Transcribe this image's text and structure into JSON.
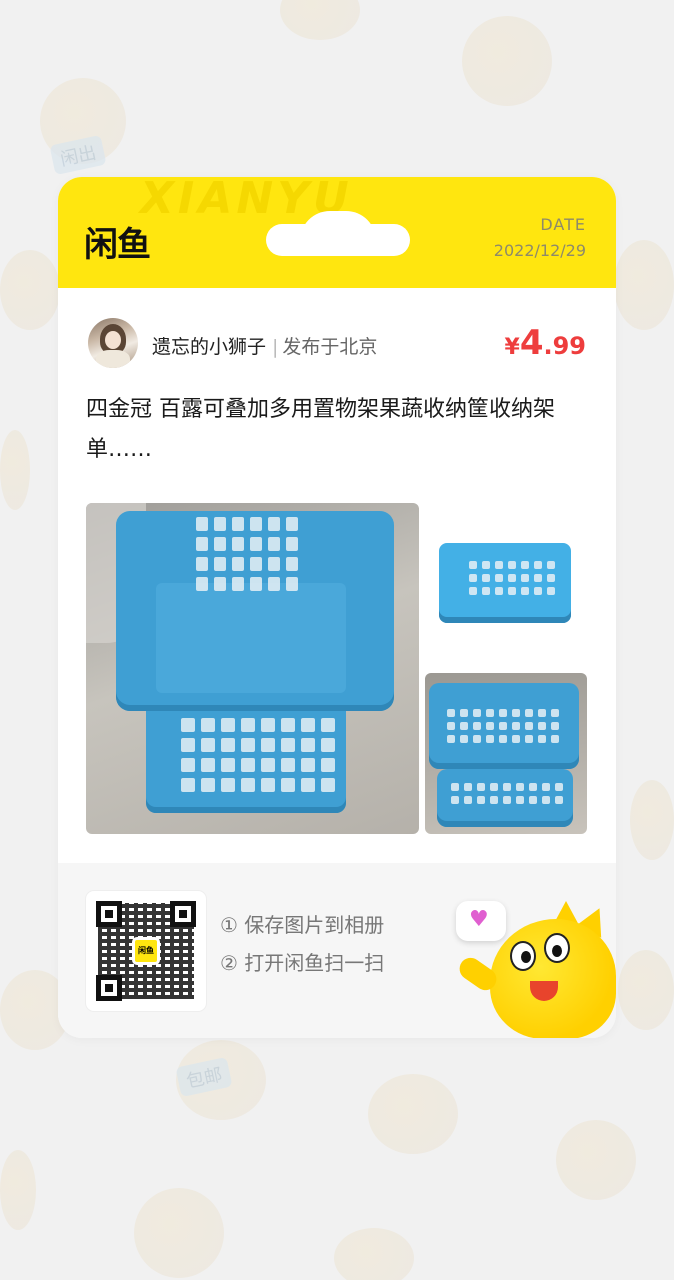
{
  "background": {
    "tags": [
      "闲出",
      "包邮"
    ]
  },
  "header": {
    "logo": "闲鱼",
    "watermark": "XIANYU",
    "date_label": "DATE",
    "date_value": "2022/12/29",
    "color": "#ffe60f"
  },
  "seller": {
    "name": "遗忘的小狮子",
    "separator": "|",
    "location": "发布于北京"
  },
  "price": {
    "currency": "¥",
    "integer": "4",
    "decimal": ".99",
    "color": "#ee3d3d"
  },
  "item": {
    "title": "四金冠 百露可叠加多用置物架果蔬收纳筐收纳架 单……"
  },
  "footer": {
    "qr_logo": "闲鱼",
    "step1": "① 保存图片到相册",
    "step2": "② 打开闲鱼扫一扫"
  }
}
